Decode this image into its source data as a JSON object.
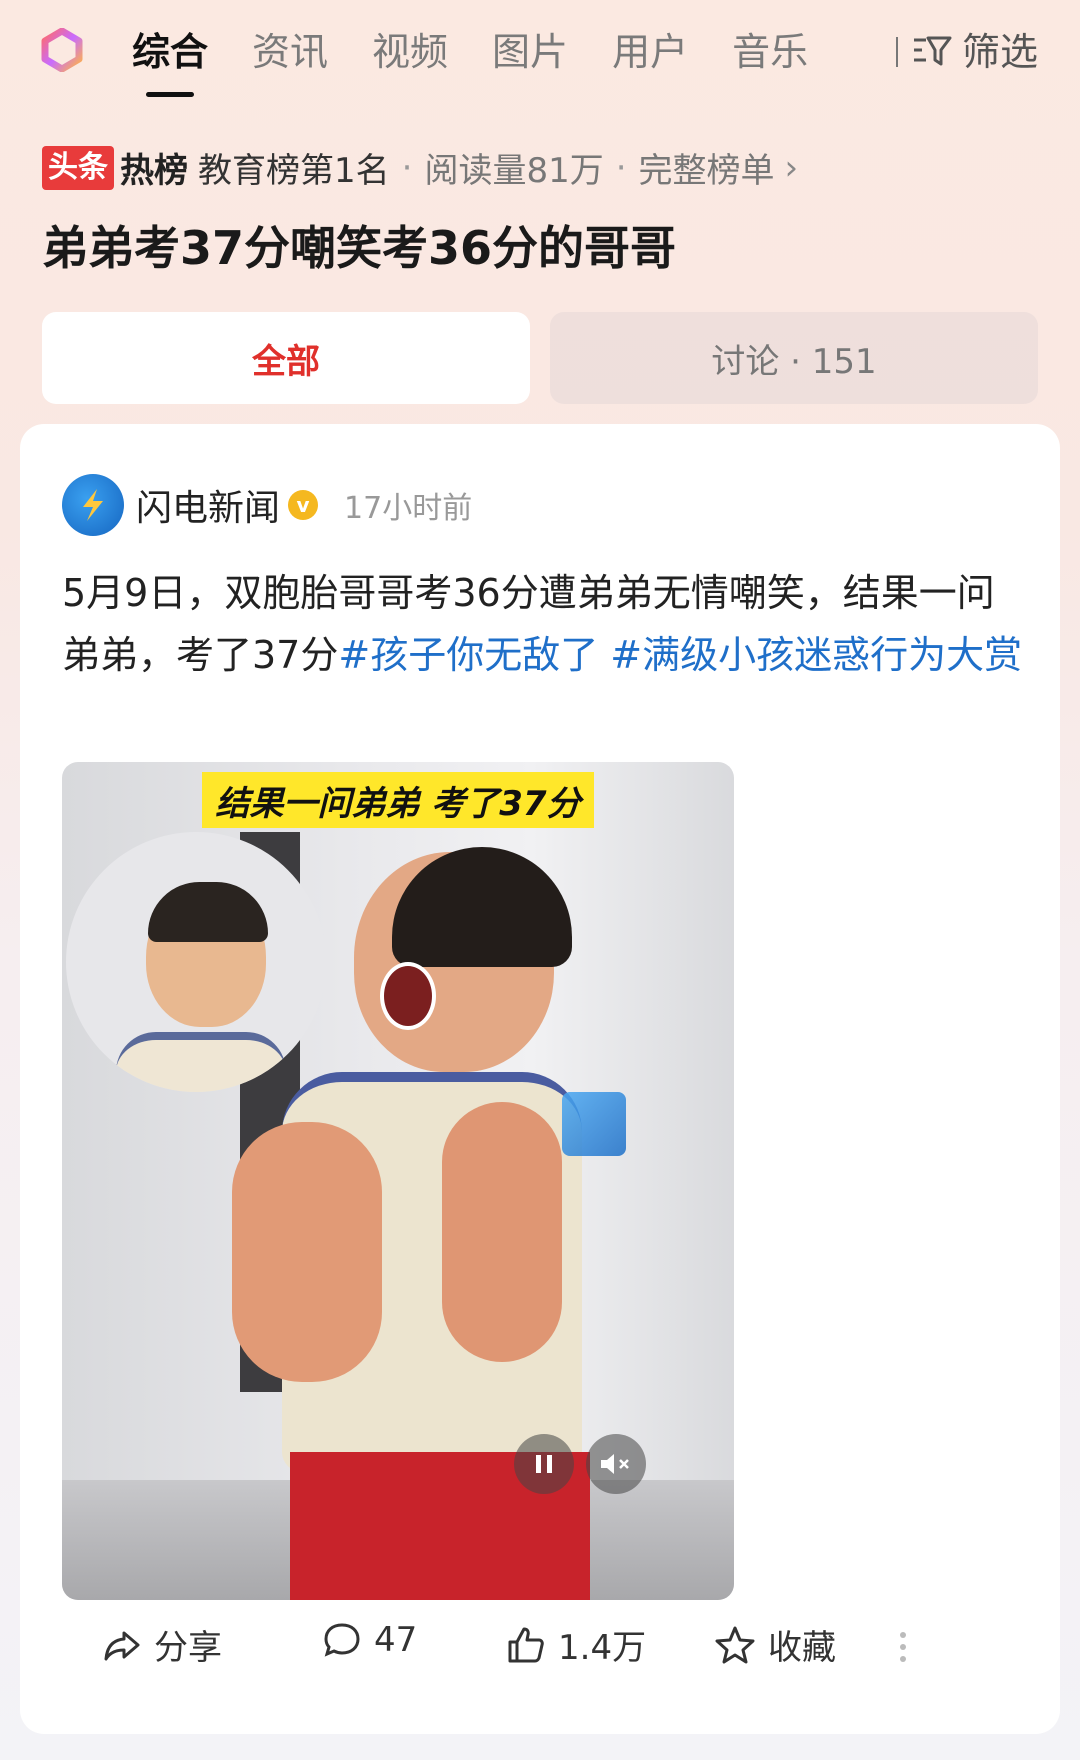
{
  "nav": {
    "tabs": [
      {
        "label": "综合",
        "active": true
      },
      {
        "label": "资讯"
      },
      {
        "label": "视频"
      },
      {
        "label": "图片"
      },
      {
        "label": "用户"
      },
      {
        "label": "音乐"
      }
    ],
    "filter_label": "筛选"
  },
  "hot": {
    "badge_left": "头条",
    "badge_right": "热榜",
    "rank": "教育榜第1名",
    "reads": "阅读量81万",
    "full_list": "完整榜单"
  },
  "headline": "弟弟考37分嘲笑考36分的哥哥",
  "segments": {
    "all": "全部",
    "discussion": "讨论 · 151"
  },
  "post": {
    "author": "闪电新闻",
    "verified_mark": "v",
    "time": "17小时前",
    "text": "5月9日，双胞胎哥哥考36分遭弟弟无情嘲笑，结果一问弟弟，考了37分",
    "tags": [
      "#孩子你无敌了",
      "#满级小孩迷惑行为大赏"
    ],
    "video_caption": "结果一问弟弟 考了37分"
  },
  "actions": {
    "share": "分享",
    "comments": "47",
    "likes": "1.4万",
    "favorite": "收藏"
  },
  "colors": {
    "accent_red": "#e0302b",
    "tag_blue": "#1f6fc9",
    "caption_yellow": "#ffe72a"
  }
}
